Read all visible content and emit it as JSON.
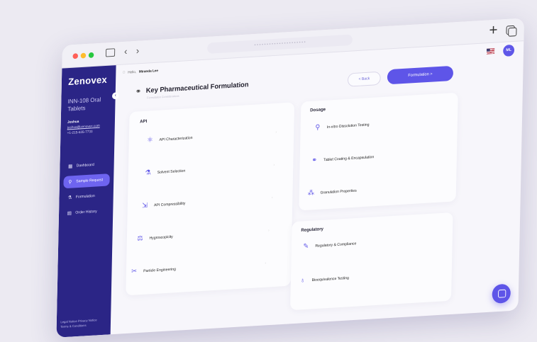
{
  "browser": {
    "url": "• • • • •   • • • • •   • • • • • • • • • • •"
  },
  "sidebar": {
    "logo": "Zenovex",
    "product": "INN-108 Oral Tablets",
    "contact_name": "Joshua",
    "contact_email": "joshua@zenovex.com",
    "contact_phone": "+1-215-635-7733",
    "items": [
      {
        "label": "Dashboard",
        "icon": "grid-icon"
      },
      {
        "label": "Sample Request",
        "icon": "link-icon"
      },
      {
        "label": "Formulation",
        "icon": "flask-icon"
      },
      {
        "label": "Order History",
        "icon": "document-icon"
      }
    ],
    "legal_1": "Legal Notice   Privacy Notice",
    "legal_2": "Terms & Conditions"
  },
  "header": {
    "greeting": "Hello,",
    "user": "Miranda Lee",
    "avatar": "ML"
  },
  "page": {
    "title": "Key Pharmaceutical Formulation",
    "subtitle": "Formulation Considerations",
    "back_label": "< Back",
    "next_label": "Formulation  >"
  },
  "api": {
    "heading": "API",
    "items": [
      "API Characterization",
      "Solvent Selection",
      "API Compressibility",
      "Hygroscopicity",
      "Particle Engineering"
    ]
  },
  "dosage": {
    "heading": "Dosage",
    "items": [
      "In-vitro Dissolution Testing",
      "Tablet Coating & Encapsulation",
      "Granulation Properties"
    ]
  },
  "regulatory": {
    "heading": "Regulatory",
    "items": [
      "Regulatory & Compliance",
      "Bioequivalence Testing"
    ]
  }
}
